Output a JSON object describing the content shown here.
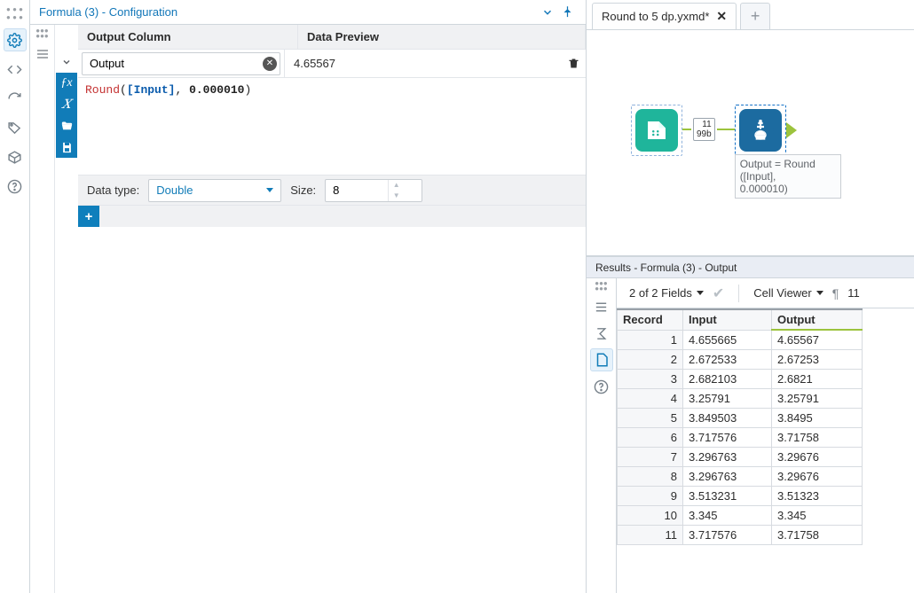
{
  "config": {
    "title": "Formula (3) - Configuration",
    "headers": {
      "output_col": "Output Column",
      "preview": "Data Preview"
    },
    "output_field": "Output",
    "preview_value": "4.65567",
    "expression_parts": {
      "fn": "Round",
      "arg1": "Input",
      "arg2": "0.000010"
    },
    "type_label": "Data type:",
    "type_value": "Double",
    "size_label": "Size:",
    "size_value": "8"
  },
  "tab": {
    "label": "Round to 5 dp.yxmd*"
  },
  "workflow": {
    "badge_rows": "11",
    "badge_bytes": "99b",
    "annotation": "Output = Round\n([Input],\n0.000010)"
  },
  "results": {
    "title": "Results - Formula (3) - Output",
    "fields_summary": "2 of 2 Fields",
    "viewer_label": "Cell Viewer",
    "row_limit": "11",
    "columns": {
      "record": "Record",
      "input": "Input",
      "output": "Output"
    },
    "rows": [
      {
        "r": "1",
        "in": "4.655665",
        "out": "4.65567"
      },
      {
        "r": "2",
        "in": "2.672533",
        "out": "2.67253"
      },
      {
        "r": "3",
        "in": "2.682103",
        "out": "2.6821"
      },
      {
        "r": "4",
        "in": "3.25791",
        "out": "3.25791"
      },
      {
        "r": "5",
        "in": "3.849503",
        "out": "3.8495"
      },
      {
        "r": "6",
        "in": "3.717576",
        "out": "3.71758"
      },
      {
        "r": "7",
        "in": "3.296763",
        "out": "3.29676"
      },
      {
        "r": "8",
        "in": "3.296763",
        "out": "3.29676"
      },
      {
        "r": "9",
        "in": "3.513231",
        "out": "3.51323"
      },
      {
        "r": "10",
        "in": "3.345",
        "out": "3.345"
      },
      {
        "r": "11",
        "in": "3.717576",
        "out": "3.71758"
      }
    ]
  }
}
